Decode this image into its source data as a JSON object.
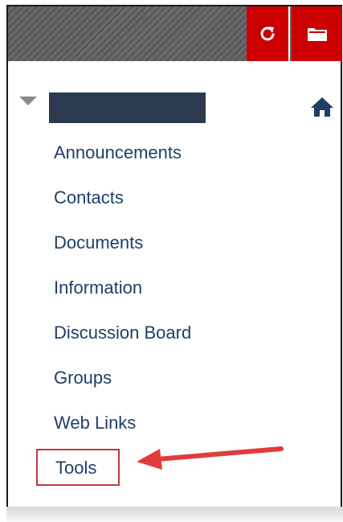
{
  "menu": {
    "items": [
      {
        "label": "Announcements"
      },
      {
        "label": "Contacts"
      },
      {
        "label": "Documents"
      },
      {
        "label": "Information"
      },
      {
        "label": "Discussion Board"
      },
      {
        "label": "Groups"
      },
      {
        "label": "Web Links"
      }
    ],
    "tools_label": "Tools"
  },
  "icons": {
    "refresh": "refresh-icon",
    "folder": "folder-icon",
    "home": "home-icon",
    "caret": "caret-down-icon"
  },
  "colors": {
    "accent": "#cc0000",
    "link": "#1e3f66",
    "highlight": "#c0393b",
    "title_block": "#2b3a4f"
  }
}
